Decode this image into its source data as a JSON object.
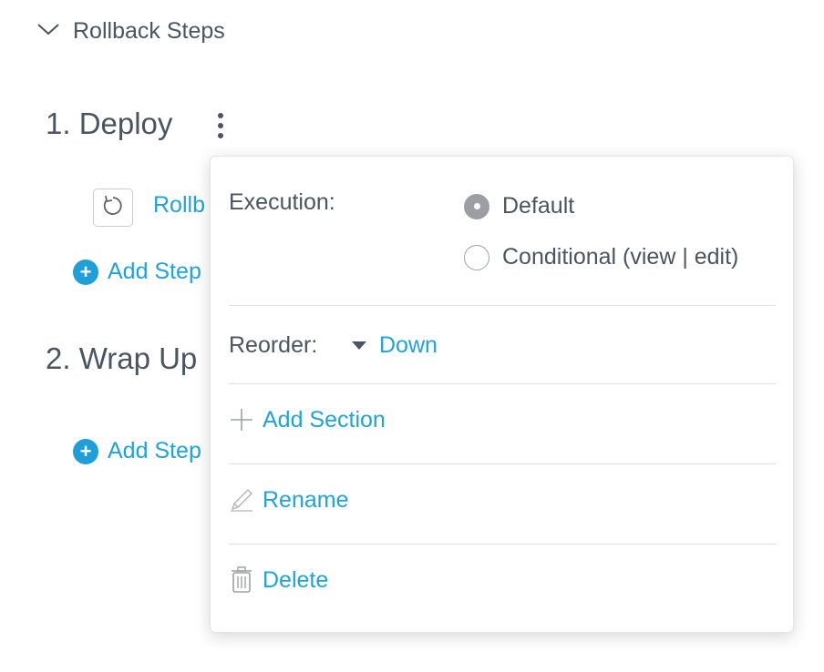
{
  "section": {
    "label": "Rollback Steps",
    "icon": "chevron-down-icon"
  },
  "groups": [
    {
      "title": "1. Deploy",
      "step_label": "Rollb",
      "add_step_label": "Add Step"
    },
    {
      "title": "2. Wrap Up",
      "add_step_label": "Add Step"
    }
  ],
  "menu": {
    "execution_label": "Execution:",
    "execution_options": [
      {
        "label": "Default",
        "selected": true
      },
      {
        "label": "Conditional (view | edit)",
        "selected": false
      }
    ],
    "reorder_label": "Reorder:",
    "reorder_value": "Down",
    "add_section_label": "Add Section",
    "rename_label": "Rename",
    "delete_label": "Delete"
  },
  "colors": {
    "link": "#1ea4dd",
    "text": "#4a5561",
    "add_button": "#1e9fda"
  }
}
